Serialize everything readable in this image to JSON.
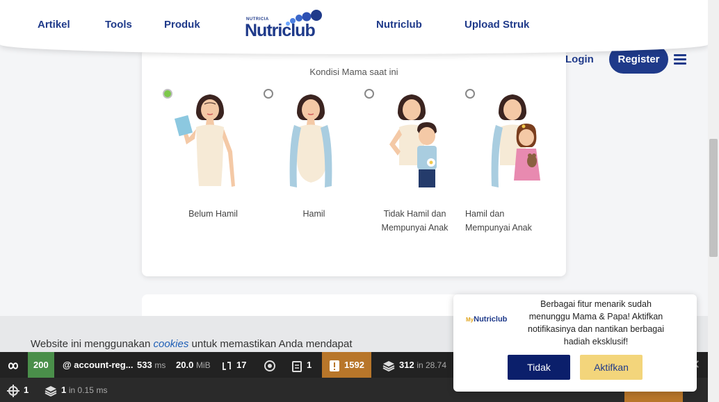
{
  "nav": {
    "items": [
      "Artikel",
      "Tools",
      "Produk",
      "Nutriclub",
      "Upload Struk"
    ],
    "logo_small": "NUTRICIA",
    "logo_main": "Nutriclub",
    "login": "Login",
    "register": "Register"
  },
  "card": {
    "title": "Kondisi Mama saat ini",
    "options": [
      {
        "label_line1": "Belum Hamil",
        "label_line2": "",
        "selected": true
      },
      {
        "label_line1": "Hamil",
        "label_line2": "",
        "selected": false
      },
      {
        "label_line1": "Tidak Hamil dan",
        "label_line2": "Mempunyai Anak",
        "selected": false
      },
      {
        "label_line1": "Hamil dan",
        "label_line2": "Mempunyai Anak",
        "selected": false
      }
    ]
  },
  "cookie": {
    "text_before": "Website ini menggunakan ",
    "link": "cookies",
    "text_after": " untuk memastikan Anda mendapat"
  },
  "debug": {
    "status": "200",
    "route": "@ account-reg...",
    "time": "533",
    "time_unit": "ms",
    "memory": "20.0",
    "memory_unit": "MiB",
    "requests": "17",
    "logs": "1",
    "warnings": "1592",
    "queries": "312",
    "queries_time": "in 28.74",
    "row2_count": "1",
    "row2_layers": "1",
    "row2_time": "in 0.15",
    "row2_unit": "ms"
  },
  "notification": {
    "logo_prefix": "My",
    "logo_main": "Nutriclub",
    "text": "Berbagai fitur menarik sudah menunggu Mama & Papa! Aktifkan notifikasinya dan nantikan berbagai hadiah eksklusif!",
    "decline": "Tidak",
    "accept": "Aktifkan"
  },
  "colors": {
    "brand": "#1f3a8a",
    "selected_radio": "#7cc84a",
    "accept_button": "#f3d57b"
  }
}
